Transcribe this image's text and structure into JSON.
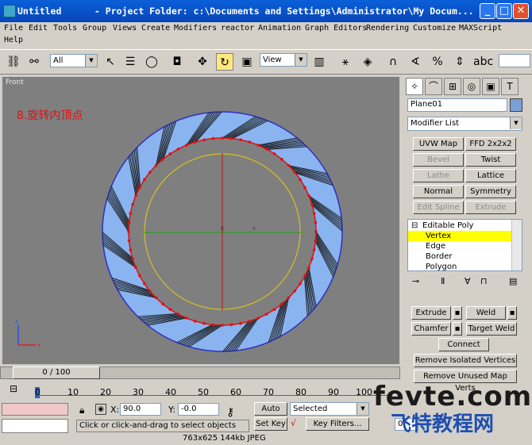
{
  "window": {
    "title": "Untitled      - Project Folder: c:\\Documents and Settings\\Administrator\\My Docum..."
  },
  "menu": [
    {
      "label": "File"
    },
    {
      "label": "Edit"
    },
    {
      "label": "Tools"
    },
    {
      "label": "Group"
    },
    {
      "label": "Views"
    },
    {
      "label": "Create"
    },
    {
      "label": "Modifiers"
    },
    {
      "label": "reactor"
    },
    {
      "label": "Animation"
    },
    {
      "label": "Graph Editors"
    },
    {
      "label": "Rendering"
    },
    {
      "label": "Customize"
    },
    {
      "label": "MAXScript"
    },
    {
      "label": "Help"
    }
  ],
  "toolbar": {
    "selection_filter": "All",
    "reference_coord": "View"
  },
  "viewport": {
    "label": "Front",
    "annotation": "8.旋转内顶点"
  },
  "panel": {
    "object_name": "Plane01",
    "modifier_list": "Modifier List",
    "buttons": [
      {
        "label": "UVW Map",
        "enabled": true
      },
      {
        "label": "FFD 2x2x2",
        "enabled": true
      },
      {
        "label": "Bevel",
        "enabled": false
      },
      {
        "label": "Twist",
        "enabled": true
      },
      {
        "label": "Lathe",
        "enabled": false
      },
      {
        "label": "Lattice",
        "enabled": true
      },
      {
        "label": "Normal",
        "enabled": true
      },
      {
        "label": "Symmetry",
        "enabled": true
      },
      {
        "label": "Edit Spline",
        "enabled": false
      },
      {
        "label": "Extrude",
        "enabled": false
      }
    ],
    "stack": [
      {
        "label": "Editable Poly",
        "selected": false
      },
      {
        "label": "Vertex",
        "selected": true
      },
      {
        "label": "Edge",
        "selected": false
      },
      {
        "label": "Border",
        "selected": false
      },
      {
        "label": "Polygon",
        "selected": false
      }
    ],
    "edit_buttons": {
      "extrude": "Extrude",
      "weld": "Weld",
      "chamfer": "Chamfer",
      "target_weld": "Target Weld",
      "connect": "Connect",
      "remove_isolated": "Remove Isolated Vertices",
      "remove_unused": "Remove Unused Map Verts"
    }
  },
  "timeline": {
    "frame_display": "0 / 100",
    "ticks": [
      "0",
      "10",
      "20",
      "30",
      "40",
      "50",
      "60",
      "70",
      "80",
      "90",
      "100"
    ]
  },
  "status": {
    "x_label": "X:",
    "x_value": "90.0",
    "y_label": "Y:",
    "y_value": "-0.0",
    "auto_key": "Auto Key",
    "set_key": "Set Key",
    "key_mode": "Selected",
    "key_filters": "Key Filters...",
    "prompt": "Click or click-and-drag to select objects",
    "frame": "0"
  },
  "overlay": {
    "image_info": "763x625  144kb  JPEG",
    "watermark": "fevte.com",
    "watermark_cn": "飞特教程网"
  },
  "colors": {
    "title_blue": "#0a5fd8",
    "viewport_gray": "#7f7f7f",
    "ring_blue": "#8ab4f0",
    "selection_red": "#e01010",
    "highlight": "#ffff00"
  }
}
